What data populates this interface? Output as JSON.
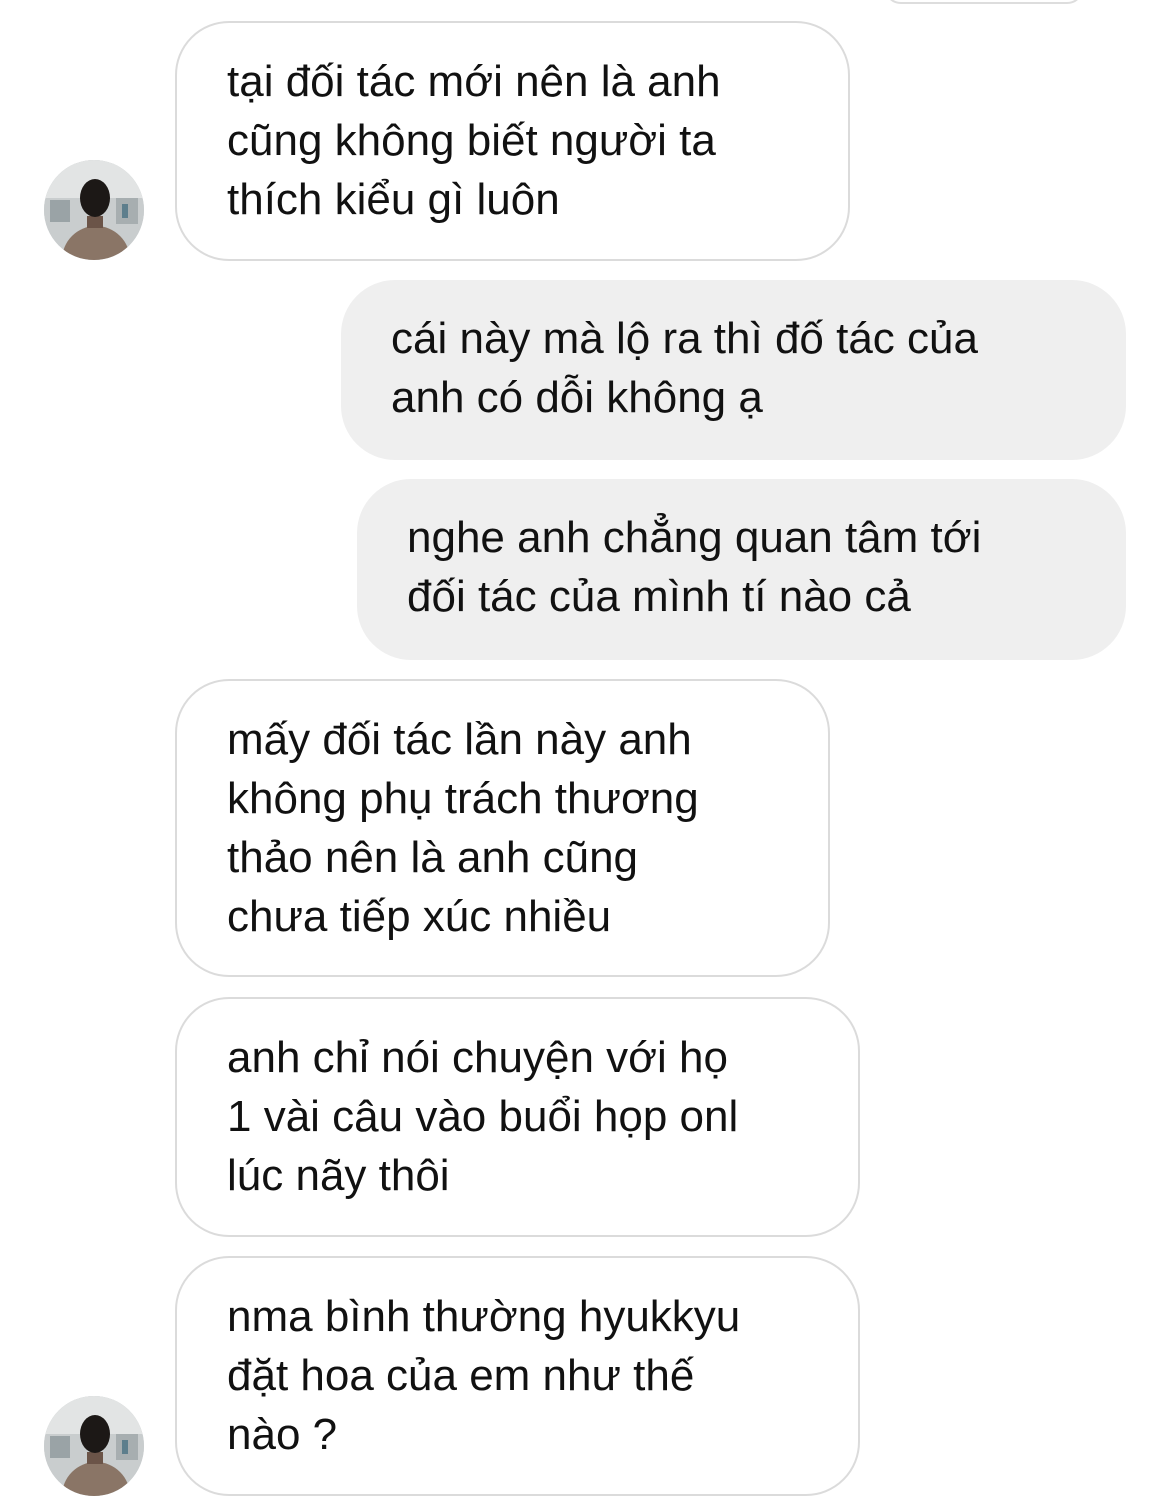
{
  "conversation": {
    "messages": [
      {
        "sender": "them",
        "text": "tại đối tác mới nên là anh\ncũng không biết người ta\nthích kiểu gì luôn"
      },
      {
        "sender": "me",
        "text": "cái này mà lộ ra thì đố tác của\nanh có dỗi không ạ"
      },
      {
        "sender": "me",
        "text": "nghe anh chẳng quan tâm tới\nđối tác của mình tí nào cả"
      },
      {
        "sender": "them",
        "text": "mấy đối tác lần này anh\nkhông phụ trách thương\nthảo nên là anh cũng\nchưa tiếp xúc nhiều"
      },
      {
        "sender": "them",
        "text": "anh chỉ nói chuyện với họ\n1 vài câu vào buổi họp onl\nlúc nãy thôi"
      },
      {
        "sender": "them",
        "text": "nma bình thường hyukkyu\nđặt hoa của em như thế\nnào ?"
      }
    ]
  },
  "colors": {
    "incoming_bubble_bg": "#ffffff",
    "incoming_bubble_border": "#dbdbdb",
    "outgoing_bubble_bg": "#efefef",
    "text": "#111111"
  },
  "icons": {
    "avatar": "contact-avatar-photo"
  }
}
